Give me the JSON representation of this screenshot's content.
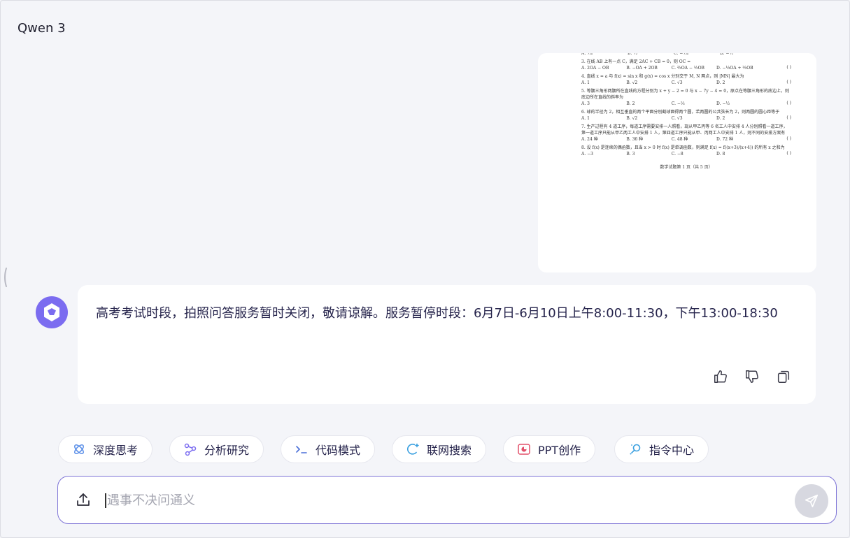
{
  "app": {
    "title": "Qwen 3"
  },
  "document": {
    "questions": [
      {
        "text": "",
        "options": [
          "A. ½i",
          "B. ½",
          "C. −½i",
          "D. −½"
        ]
      },
      {
        "text": "3. 在线 AB 上有一点 C，满足 2AC + CB = 0，则 OC =",
        "paren": "(    )",
        "options": [
          "A. 2OA − OB",
          "B. −OA + 2OB",
          "C. ⅔OA − ⅓OB",
          "D. −⅓OA + ⅔OB"
        ]
      },
      {
        "text": "4. 直线 x = a 与 f(x) = sin x 和 g(x) = cos x 分别交于 M, N 两点，则 |MN| 最大为",
        "paren": "(    )",
        "options": [
          "A. 1",
          "B. √2",
          "C. √3",
          "D. 2"
        ]
      },
      {
        "text": "5. 等腰三角形两腰所在直线的方程分别为 x + y − 2 = 0 与 x − 7y − 4 = 0，原点在等腰三角形的底边上，则底边所在直线的斜率为",
        "paren": "(    )",
        "options": [
          "A. 3",
          "B. 2",
          "C. −⅓",
          "D. −½"
        ]
      },
      {
        "text": "6. 球的半径为 2，相互垂直的两个平面分别截球面得两个圆，若两圆的公共弦长为 2，则两圆的圆心距等于",
        "paren": "(    )",
        "options": [
          "A. 1",
          "B. √2",
          "C. √3",
          "D. 2"
        ]
      },
      {
        "text": "7. 生产过程有 4 道工序，每道工序需要安排一人照看，现从甲乙丙等 6 名工人中安排 4 人分别照看一道工序，第一道工序只能从甲乙两工人中安排 1 人，第四道工序只能从甲、丙两工人中安排 1 人，则不同的安排方案有",
        "paren": "(    )",
        "options": [
          "A. 24 种",
          "B. 36 种",
          "C. 48 种",
          "D. 72 种"
        ]
      },
      {
        "text": "8. 设 f(x) 是连续的偶函数，且当 x > 0 时 f(x) 是单调函数，则满足 f(x) = f((x+3)/(x+4)) 的所有 x 之和为",
        "paren": "(    )",
        "options": [
          "A. −3",
          "B. 3",
          "C. −8",
          "D. 8"
        ]
      }
    ],
    "footer": "数学试题第 1 页（共 5 页）"
  },
  "message": {
    "text": "高考考试时段，拍照问答服务暂时关闭，敬请谅解。服务暂停时段：6月7日-6月10日上午8:00-11:30，下午13:00-18:30"
  },
  "actions": [
    "thumbs-up",
    "thumbs-down",
    "copy"
  ],
  "chips": [
    {
      "label": "深度思考",
      "icon": "deep-think-icon"
    },
    {
      "label": "分析研究",
      "icon": "analysis-icon"
    },
    {
      "label": "代码模式",
      "icon": "terminal-icon"
    },
    {
      "label": "联网搜索",
      "icon": "web-search-icon"
    },
    {
      "label": "PPT创作",
      "icon": "ppt-icon"
    },
    {
      "label": "指令中心",
      "icon": "command-icon"
    }
  ],
  "input": {
    "placeholder": "遇事不决问通义",
    "value": ""
  },
  "colors": {
    "accent": "#7d73d6",
    "avatar": "#7b6cf0",
    "send_disabled": "#d7d8e0",
    "background": "#f4f5f9"
  }
}
